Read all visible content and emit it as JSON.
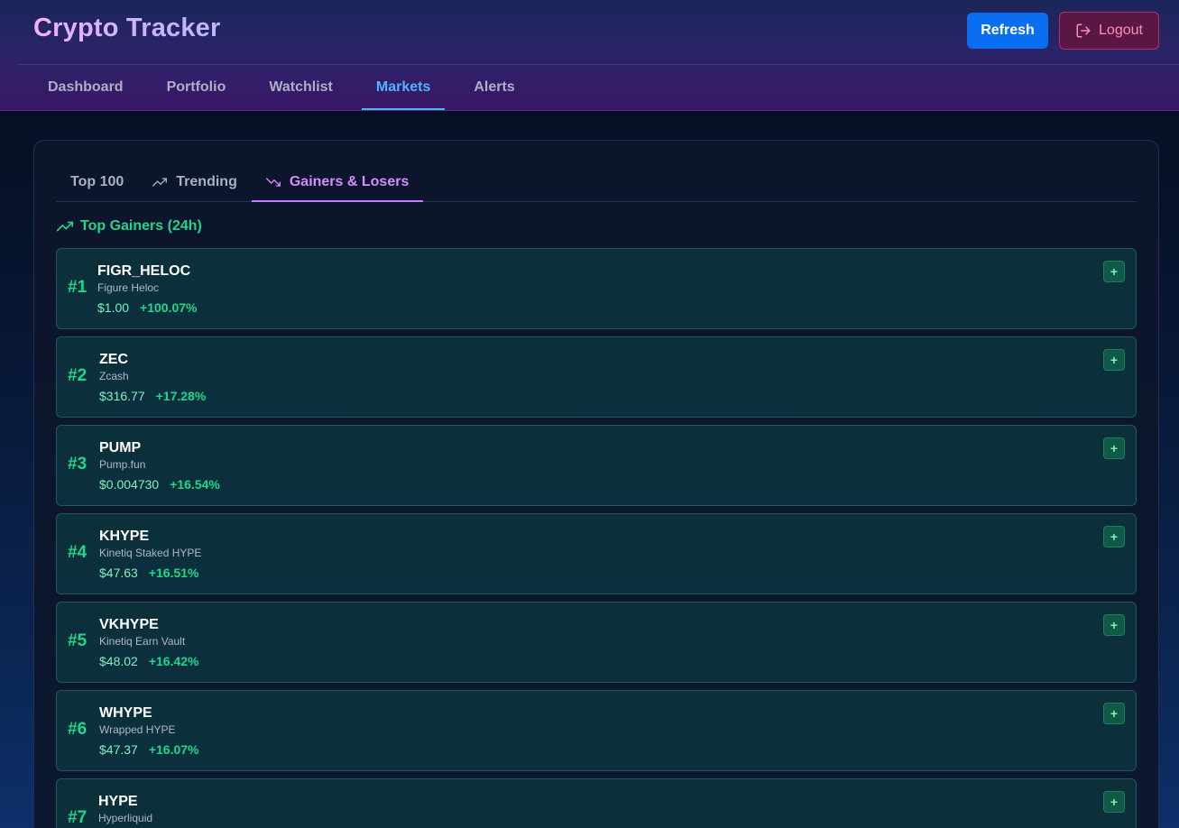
{
  "header": {
    "title": "Crypto Tracker",
    "refresh_label": "Refresh",
    "logout_label": "Logout"
  },
  "nav": {
    "items": [
      "Dashboard",
      "Portfolio",
      "Watchlist",
      "Markets",
      "Alerts"
    ],
    "active": "Markets"
  },
  "markets": {
    "tabs": [
      "Top 100",
      "Trending",
      "Gainers & Losers"
    ],
    "active_tab": "Gainers & Losers",
    "section_title": "Top Gainers (24h)",
    "add_label": "+",
    "gainers": [
      {
        "rank": "#1",
        "symbol": "FIGR_HELOC",
        "name": "Figure Heloc",
        "price": "$1.00",
        "change": "+100.07%"
      },
      {
        "rank": "#2",
        "symbol": "ZEC",
        "name": "Zcash",
        "price": "$316.77",
        "change": "+17.28%"
      },
      {
        "rank": "#3",
        "symbol": "PUMP",
        "name": "Pump.fun",
        "price": "$0.004730",
        "change": "+16.54%"
      },
      {
        "rank": "#4",
        "symbol": "KHYPE",
        "name": "Kinetiq Staked HYPE",
        "price": "$47.63",
        "change": "+16.51%"
      },
      {
        "rank": "#5",
        "symbol": "VKHYPE",
        "name": "Kinetiq Earn Vault",
        "price": "$48.02",
        "change": "+16.42%"
      },
      {
        "rank": "#6",
        "symbol": "WHYPE",
        "name": "Wrapped HYPE",
        "price": "$47.37",
        "change": "+16.07%"
      },
      {
        "rank": "#7",
        "symbol": "HYPE",
        "name": "Hyperliquid",
        "price": "",
        "change": ""
      }
    ]
  },
  "colors": {
    "accent_blue": "#0a6ef0",
    "gain_green": "#1fd78a",
    "active_purple": "#c77dff",
    "logout_pink": "#ff8fb3"
  }
}
